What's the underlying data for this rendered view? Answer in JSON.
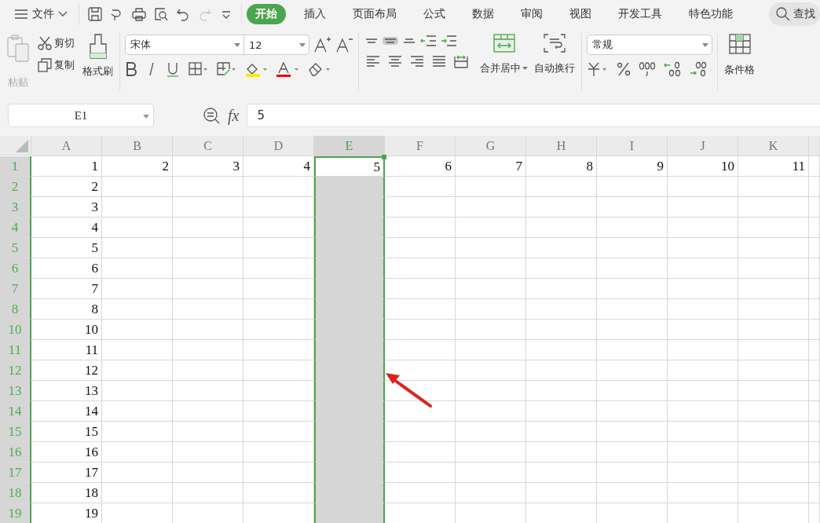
{
  "menu": {
    "label": "文件"
  },
  "tabs": [
    {
      "label": "开始",
      "selected": true
    },
    {
      "label": "插入",
      "selected": false
    },
    {
      "label": "页面布局",
      "selected": false
    },
    {
      "label": "公式",
      "selected": false
    },
    {
      "label": "数据",
      "selected": false
    },
    {
      "label": "审阅",
      "selected": false
    },
    {
      "label": "视图",
      "selected": false
    },
    {
      "label": "开发工具",
      "selected": false
    },
    {
      "label": "特色功能",
      "selected": false
    }
  ],
  "search": {
    "label": "查找"
  },
  "ribbon": {
    "paste": {
      "label": "粘贴",
      "disabled": true
    },
    "cut": {
      "label": "剪切"
    },
    "copy": {
      "label": "复制"
    },
    "format_painter": {
      "label": "格式刷"
    },
    "font": {
      "value": "宋体"
    },
    "font_size": {
      "value": "12"
    },
    "vertical_align": [
      {
        "selected": false
      },
      {
        "selected": true
      },
      {
        "selected": false
      }
    ],
    "merge": {
      "label": "合并居中"
    },
    "wrap": {
      "label": "自动换行"
    },
    "number_format": {
      "value": "常规"
    },
    "conditional_format": {
      "label": "条件格"
    }
  },
  "name_box": {
    "value": "E1"
  },
  "function_label": "fx",
  "formula": {
    "value": "5"
  },
  "sheet": {
    "columns": [
      {
        "label": "A",
        "selected": false
      },
      {
        "label": "B",
        "selected": false
      },
      {
        "label": "C",
        "selected": false
      },
      {
        "label": "D",
        "selected": false
      },
      {
        "label": "E",
        "selected": true
      },
      {
        "label": "F",
        "selected": false
      },
      {
        "label": "G",
        "selected": false
      },
      {
        "label": "H",
        "selected": false
      },
      {
        "label": "I",
        "selected": false
      },
      {
        "label": "J",
        "selected": false
      },
      {
        "label": "K",
        "selected": false
      }
    ],
    "rows": [
      {
        "label": "1",
        "cells": [
          "1",
          "2",
          "3",
          "4",
          "5",
          "6",
          "7",
          "8",
          "9",
          "10",
          "11"
        ]
      },
      {
        "label": "2",
        "cells": [
          "2"
        ]
      },
      {
        "label": "3",
        "cells": [
          "3"
        ]
      },
      {
        "label": "4",
        "cells": [
          "4"
        ]
      },
      {
        "label": "5",
        "cells": [
          "5"
        ]
      },
      {
        "label": "6",
        "cells": [
          "6"
        ]
      },
      {
        "label": "7",
        "cells": [
          "7"
        ]
      },
      {
        "label": "8",
        "cells": [
          "8"
        ]
      },
      {
        "label": "10",
        "cells": [
          "10"
        ]
      },
      {
        "label": "11",
        "cells": [
          "11"
        ]
      },
      {
        "label": "12",
        "cells": [
          "12"
        ]
      },
      {
        "label": "13",
        "cells": [
          "13"
        ]
      },
      {
        "label": "14",
        "cells": [
          "14"
        ]
      },
      {
        "label": "15",
        "cells": [
          "15"
        ]
      },
      {
        "label": "16",
        "cells": [
          "16"
        ]
      },
      {
        "label": "17",
        "cells": [
          "17"
        ]
      },
      {
        "label": "18",
        "cells": [
          "18"
        ]
      },
      {
        "label": "19",
        "cells": [
          "19"
        ]
      }
    ]
  }
}
